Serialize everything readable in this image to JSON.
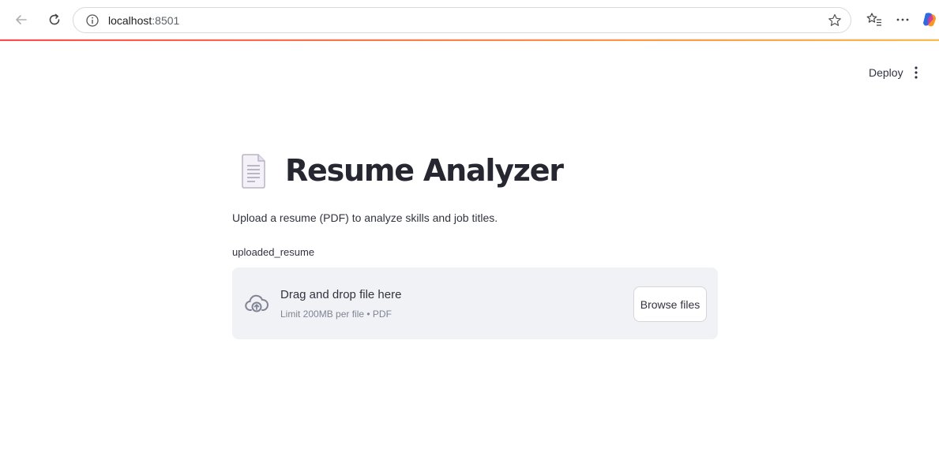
{
  "browser": {
    "url_host": "localhost",
    "url_port": ":8501",
    "icons": [
      "back-arrow-icon",
      "reload-icon",
      "info-icon",
      "star-icon",
      "favorites-icon",
      "more-icon",
      "copilot-icon"
    ]
  },
  "header": {
    "deploy_label": "Deploy",
    "menu_icon": "kebab-menu-icon"
  },
  "main": {
    "title_icon": "document-icon",
    "title": "Resume Analyzer",
    "description": "Upload a resume (PDF) to analyze skills and job titles.",
    "uploader": {
      "label": "uploaded_resume",
      "drop_title": "Drag and drop file here",
      "drop_subtitle": "Limit 200MB per file • PDF",
      "browse_label": "Browse files",
      "icon": "cloud-upload-icon"
    }
  },
  "colors": {
    "accent_start": "#ff4b4b",
    "accent_end": "#ffbd45",
    "dropzone_bg": "#f0f2f6",
    "text": "#31333f"
  }
}
